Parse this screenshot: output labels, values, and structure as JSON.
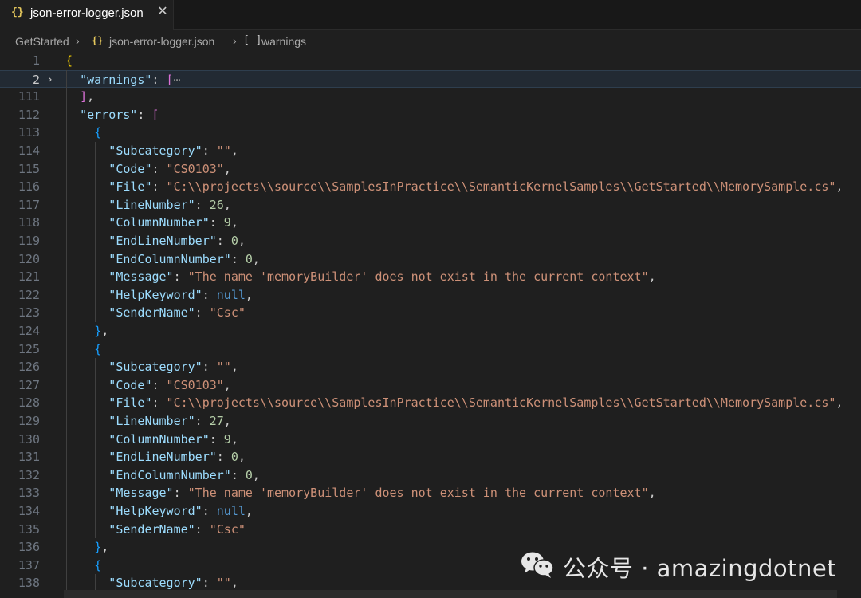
{
  "tab": {
    "icon": "{}",
    "label": "json-error-logger.json",
    "close": "✕"
  },
  "breadcrumb": {
    "folder": "GetStarted",
    "file_icon": "{}",
    "file": "json-error-logger.json",
    "array_icon": "[ ]",
    "node": "warnings"
  },
  "editor": {
    "lines": [
      {
        "n": "1",
        "indent": 0,
        "parts": [
          [
            "b1",
            "{"
          ]
        ]
      },
      {
        "n": "2",
        "indent": 1,
        "fold": "›",
        "current": true,
        "parts": [
          [
            "k",
            "\"warnings\""
          ],
          [
            "p",
            ": "
          ],
          [
            "b2",
            "["
          ],
          [
            "ellipsis",
            "⋯"
          ]
        ]
      },
      {
        "n": "111",
        "indent": 1,
        "parts": [
          [
            "b2",
            "]"
          ],
          [
            "p",
            ","
          ]
        ]
      },
      {
        "n": "112",
        "indent": 1,
        "parts": [
          [
            "k",
            "\"errors\""
          ],
          [
            "p",
            ": "
          ],
          [
            "b2",
            "["
          ]
        ]
      },
      {
        "n": "113",
        "indent": 2,
        "parts": [
          [
            "b3",
            "{"
          ]
        ]
      },
      {
        "n": "114",
        "indent": 3,
        "parts": [
          [
            "k",
            "\"Subcategory\""
          ],
          [
            "p",
            ": "
          ],
          [
            "s",
            "\"\""
          ],
          [
            "p",
            ","
          ]
        ]
      },
      {
        "n": "115",
        "indent": 3,
        "parts": [
          [
            "k",
            "\"Code\""
          ],
          [
            "p",
            ": "
          ],
          [
            "s",
            "\"CS0103\""
          ],
          [
            "p",
            ","
          ]
        ]
      },
      {
        "n": "116",
        "indent": 3,
        "parts": [
          [
            "k",
            "\"File\""
          ],
          [
            "p",
            ": "
          ],
          [
            "s",
            "\"C:\\\\projects\\\\source\\\\SamplesInPractice\\\\SemanticKernelSamples\\\\GetStarted\\\\MemorySample.cs\""
          ],
          [
            "p",
            ","
          ]
        ]
      },
      {
        "n": "117",
        "indent": 3,
        "parts": [
          [
            "k",
            "\"LineNumber\""
          ],
          [
            "p",
            ": "
          ],
          [
            "n",
            "26"
          ],
          [
            "p",
            ","
          ]
        ]
      },
      {
        "n": "118",
        "indent": 3,
        "parts": [
          [
            "k",
            "\"ColumnNumber\""
          ],
          [
            "p",
            ": "
          ],
          [
            "n",
            "9"
          ],
          [
            "p",
            ","
          ]
        ]
      },
      {
        "n": "119",
        "indent": 3,
        "parts": [
          [
            "k",
            "\"EndLineNumber\""
          ],
          [
            "p",
            ": "
          ],
          [
            "n",
            "0"
          ],
          [
            "p",
            ","
          ]
        ]
      },
      {
        "n": "120",
        "indent": 3,
        "parts": [
          [
            "k",
            "\"EndColumnNumber\""
          ],
          [
            "p",
            ": "
          ],
          [
            "n",
            "0"
          ],
          [
            "p",
            ","
          ]
        ]
      },
      {
        "n": "121",
        "indent": 3,
        "parts": [
          [
            "k",
            "\"Message\""
          ],
          [
            "p",
            ": "
          ],
          [
            "s",
            "\"The name 'memoryBuilder' does not exist in the current context\""
          ],
          [
            "p",
            ","
          ]
        ]
      },
      {
        "n": "122",
        "indent": 3,
        "parts": [
          [
            "k",
            "\"HelpKeyword\""
          ],
          [
            "p",
            ": "
          ],
          [
            "kw",
            "null"
          ],
          [
            "p",
            ","
          ]
        ]
      },
      {
        "n": "123",
        "indent": 3,
        "parts": [
          [
            "k",
            "\"SenderName\""
          ],
          [
            "p",
            ": "
          ],
          [
            "s",
            "\"Csc\""
          ]
        ]
      },
      {
        "n": "124",
        "indent": 2,
        "parts": [
          [
            "b3",
            "}"
          ],
          [
            "p",
            ","
          ]
        ]
      },
      {
        "n": "125",
        "indent": 2,
        "parts": [
          [
            "b3",
            "{"
          ]
        ]
      },
      {
        "n": "126",
        "indent": 3,
        "parts": [
          [
            "k",
            "\"Subcategory\""
          ],
          [
            "p",
            ": "
          ],
          [
            "s",
            "\"\""
          ],
          [
            "p",
            ","
          ]
        ]
      },
      {
        "n": "127",
        "indent": 3,
        "parts": [
          [
            "k",
            "\"Code\""
          ],
          [
            "p",
            ": "
          ],
          [
            "s",
            "\"CS0103\""
          ],
          [
            "p",
            ","
          ]
        ]
      },
      {
        "n": "128",
        "indent": 3,
        "parts": [
          [
            "k",
            "\"File\""
          ],
          [
            "p",
            ": "
          ],
          [
            "s",
            "\"C:\\\\projects\\\\source\\\\SamplesInPractice\\\\SemanticKernelSamples\\\\GetStarted\\\\MemorySample.cs\""
          ],
          [
            "p",
            ","
          ]
        ]
      },
      {
        "n": "129",
        "indent": 3,
        "parts": [
          [
            "k",
            "\"LineNumber\""
          ],
          [
            "p",
            ": "
          ],
          [
            "n",
            "27"
          ],
          [
            "p",
            ","
          ]
        ]
      },
      {
        "n": "130",
        "indent": 3,
        "parts": [
          [
            "k",
            "\"ColumnNumber\""
          ],
          [
            "p",
            ": "
          ],
          [
            "n",
            "9"
          ],
          [
            "p",
            ","
          ]
        ]
      },
      {
        "n": "131",
        "indent": 3,
        "parts": [
          [
            "k",
            "\"EndLineNumber\""
          ],
          [
            "p",
            ": "
          ],
          [
            "n",
            "0"
          ],
          [
            "p",
            ","
          ]
        ]
      },
      {
        "n": "132",
        "indent": 3,
        "parts": [
          [
            "k",
            "\"EndColumnNumber\""
          ],
          [
            "p",
            ": "
          ],
          [
            "n",
            "0"
          ],
          [
            "p",
            ","
          ]
        ]
      },
      {
        "n": "133",
        "indent": 3,
        "parts": [
          [
            "k",
            "\"Message\""
          ],
          [
            "p",
            ": "
          ],
          [
            "s",
            "\"The name 'memoryBuilder' does not exist in the current context\""
          ],
          [
            "p",
            ","
          ]
        ]
      },
      {
        "n": "134",
        "indent": 3,
        "parts": [
          [
            "k",
            "\"HelpKeyword\""
          ],
          [
            "p",
            ": "
          ],
          [
            "kw",
            "null"
          ],
          [
            "p",
            ","
          ]
        ]
      },
      {
        "n": "135",
        "indent": 3,
        "parts": [
          [
            "k",
            "\"SenderName\""
          ],
          [
            "p",
            ": "
          ],
          [
            "s",
            "\"Csc\""
          ]
        ]
      },
      {
        "n": "136",
        "indent": 2,
        "parts": [
          [
            "b3",
            "}"
          ],
          [
            "p",
            ","
          ]
        ]
      },
      {
        "n": "137",
        "indent": 2,
        "parts": [
          [
            "b3",
            "{"
          ]
        ]
      },
      {
        "n": "138",
        "indent": 3,
        "parts": [
          [
            "k",
            "\"Subcategory\""
          ],
          [
            "p",
            ": "
          ],
          [
            "s",
            "\"\""
          ],
          [
            "p",
            ","
          ]
        ]
      }
    ]
  },
  "watermark": {
    "text": "公众号 · amazingdotnet",
    "icon": "wechat-icon"
  },
  "colors": {
    "key": "#9cdcfe",
    "string": "#ce9178",
    "number": "#b5cea8",
    "keyword": "#569cd6",
    "bracket_level1": "#ffd700",
    "bracket_level2": "#da70d6",
    "bracket_level3": "#179fff",
    "json_icon": "#e3c65c"
  }
}
